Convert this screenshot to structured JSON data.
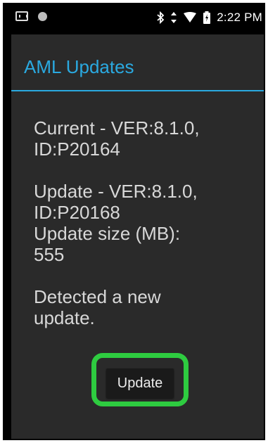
{
  "status_bar": {
    "left_icons": [
      "scanner-icon",
      "circle-icon"
    ],
    "right_icons": [
      "bluetooth-icon",
      "data-arrows-icon",
      "wifi-icon",
      "battery-icon"
    ],
    "time": "2:22 PM"
  },
  "dialog": {
    "title": "AML Updates",
    "current_line1": "Current - VER:8.1.0,",
    "current_line2": "ID:P20164",
    "update_line1": "Update - VER:8.1.0,",
    "update_line2": "ID:P20168",
    "update_size_label": "Update size (MB):",
    "update_size_value": "555",
    "detected_line1": "Detected a new",
    "detected_line2": "update.",
    "update_button": "Update"
  },
  "colors": {
    "accent": "#2aa9e0",
    "highlight": "#2ecc40",
    "dialog_bg": "#2a2a2a",
    "text": "#d8d8d8"
  }
}
